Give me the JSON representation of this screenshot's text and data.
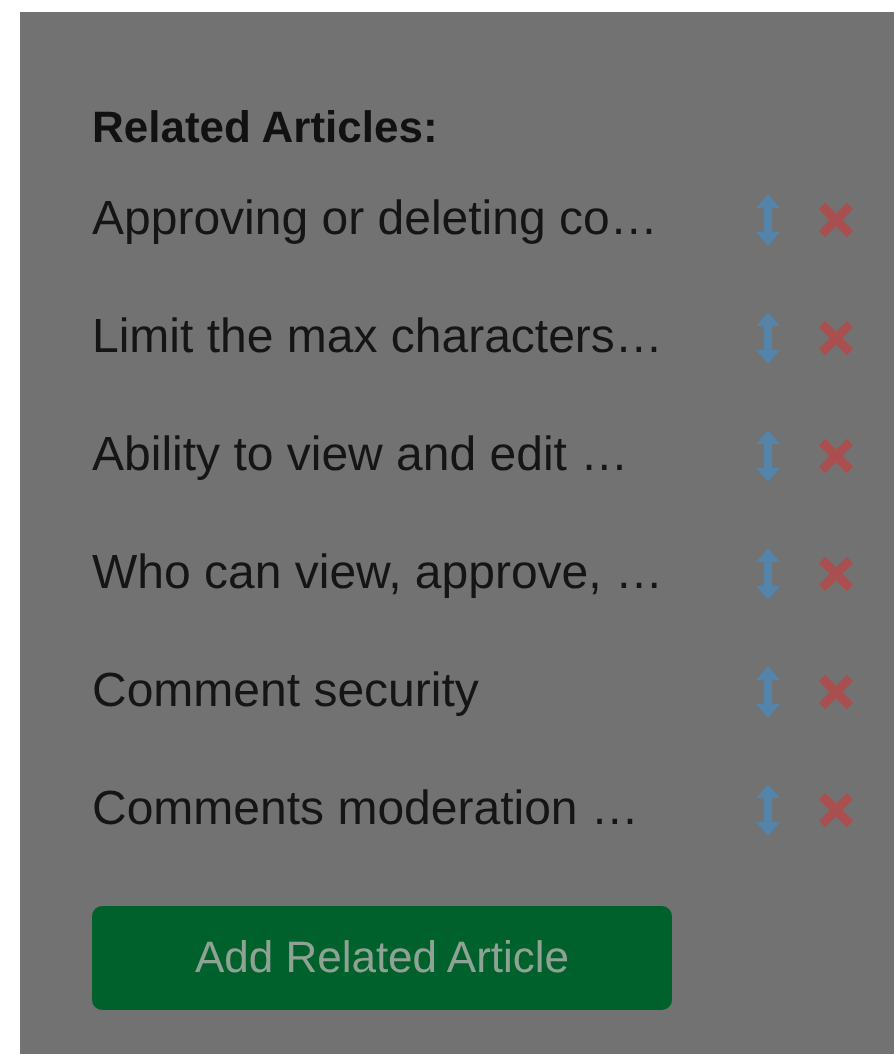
{
  "heading": "Related Articles:",
  "articles": [
    {
      "title": "Approving or deleting co…"
    },
    {
      "title": "Limit the max characters…"
    },
    {
      "title": "Ability to view and edit …"
    },
    {
      "title": "Who can view, approve, …"
    },
    {
      "title": "Comment security"
    },
    {
      "title": "Comments moderation …"
    }
  ],
  "add_button": "Add Related Article"
}
